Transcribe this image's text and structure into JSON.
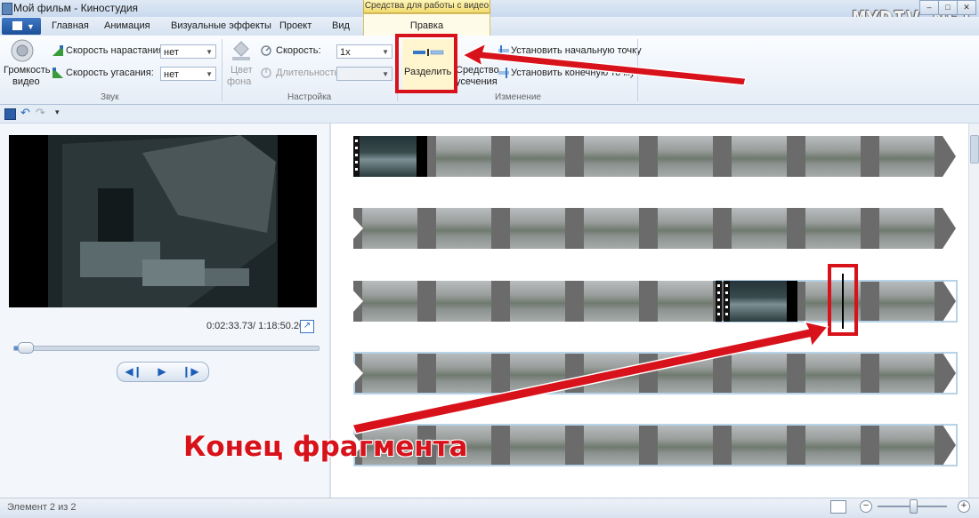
{
  "window": {
    "title": "Мой фильм - Киностудия",
    "context_tab_title": "Средства для работы с видео",
    "controls": [
      "–",
      "□",
      "✕"
    ]
  },
  "tabs": [
    "Главная",
    "Анимация",
    "Визуальные эффекты",
    "Проект",
    "Вид",
    "Правка"
  ],
  "active_tab": "Правка",
  "ribbon": {
    "sound": {
      "volume_label_line1": "Громкость",
      "volume_label_line2": "видео",
      "fade_in_label": "Скорость нарастания:",
      "fade_in_value": "нет",
      "fade_out_label": "Скорость угасания:",
      "fade_out_value": "нет",
      "group_label": "Звук"
    },
    "adjust": {
      "bg_color_line1": "Цвет",
      "bg_color_line2": "фона",
      "speed_label": "Скорость:",
      "speed_value": "1x",
      "duration_label": "Длительность:",
      "duration_value": "",
      "group_label": "Настройка"
    },
    "edit": {
      "split_label": "Разделить",
      "trim_line1": "Средство",
      "trim_line2": "усечения",
      "set_start": "Установить начальную точку",
      "set_end": "Установить конечную точку",
      "group_label": "Изменение"
    }
  },
  "preview": {
    "timecode": "0:02:33.73/ 1:18:50.20",
    "seek_fraction": 0.02
  },
  "status": {
    "text": "Элемент 2 из 2",
    "zoom_fraction": 0.55
  },
  "annotation": {
    "label": "Конец фрагмента"
  },
  "watermark": "MYDIV.NET",
  "colors": {
    "accent_red": "#d8121b",
    "ribbon_blue": "#1d4f98",
    "context_yellow": "#f2dc6f"
  }
}
